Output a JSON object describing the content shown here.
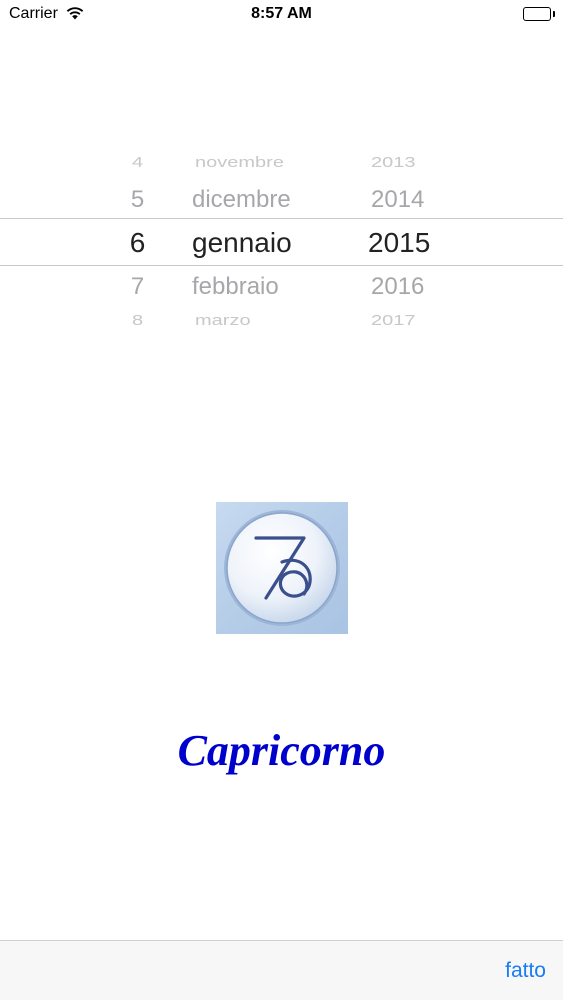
{
  "status_bar": {
    "carrier": "Carrier",
    "time": "8:57 AM",
    "wifi_icon": "wifi-icon",
    "battery_icon": "battery-icon",
    "battery_level": 1.0
  },
  "picker": {
    "rows": [
      {
        "day": "4",
        "month": "novembre",
        "year": "2013"
      },
      {
        "day": "5",
        "month": "dicembre",
        "year": "2014"
      },
      {
        "day": "6",
        "month": "gennaio",
        "year": "2015"
      },
      {
        "day": "7",
        "month": "febbraio",
        "year": "2016"
      },
      {
        "day": "8",
        "month": "marzo",
        "year": "2017"
      }
    ],
    "selected_index": 2
  },
  "zodiac": {
    "icon": "capricorn-symbol-icon",
    "name": "Capricorno",
    "name_color": "#0000cc"
  },
  "toolbar": {
    "done_label": "fatto",
    "accent_color": "#1a7cf5"
  }
}
